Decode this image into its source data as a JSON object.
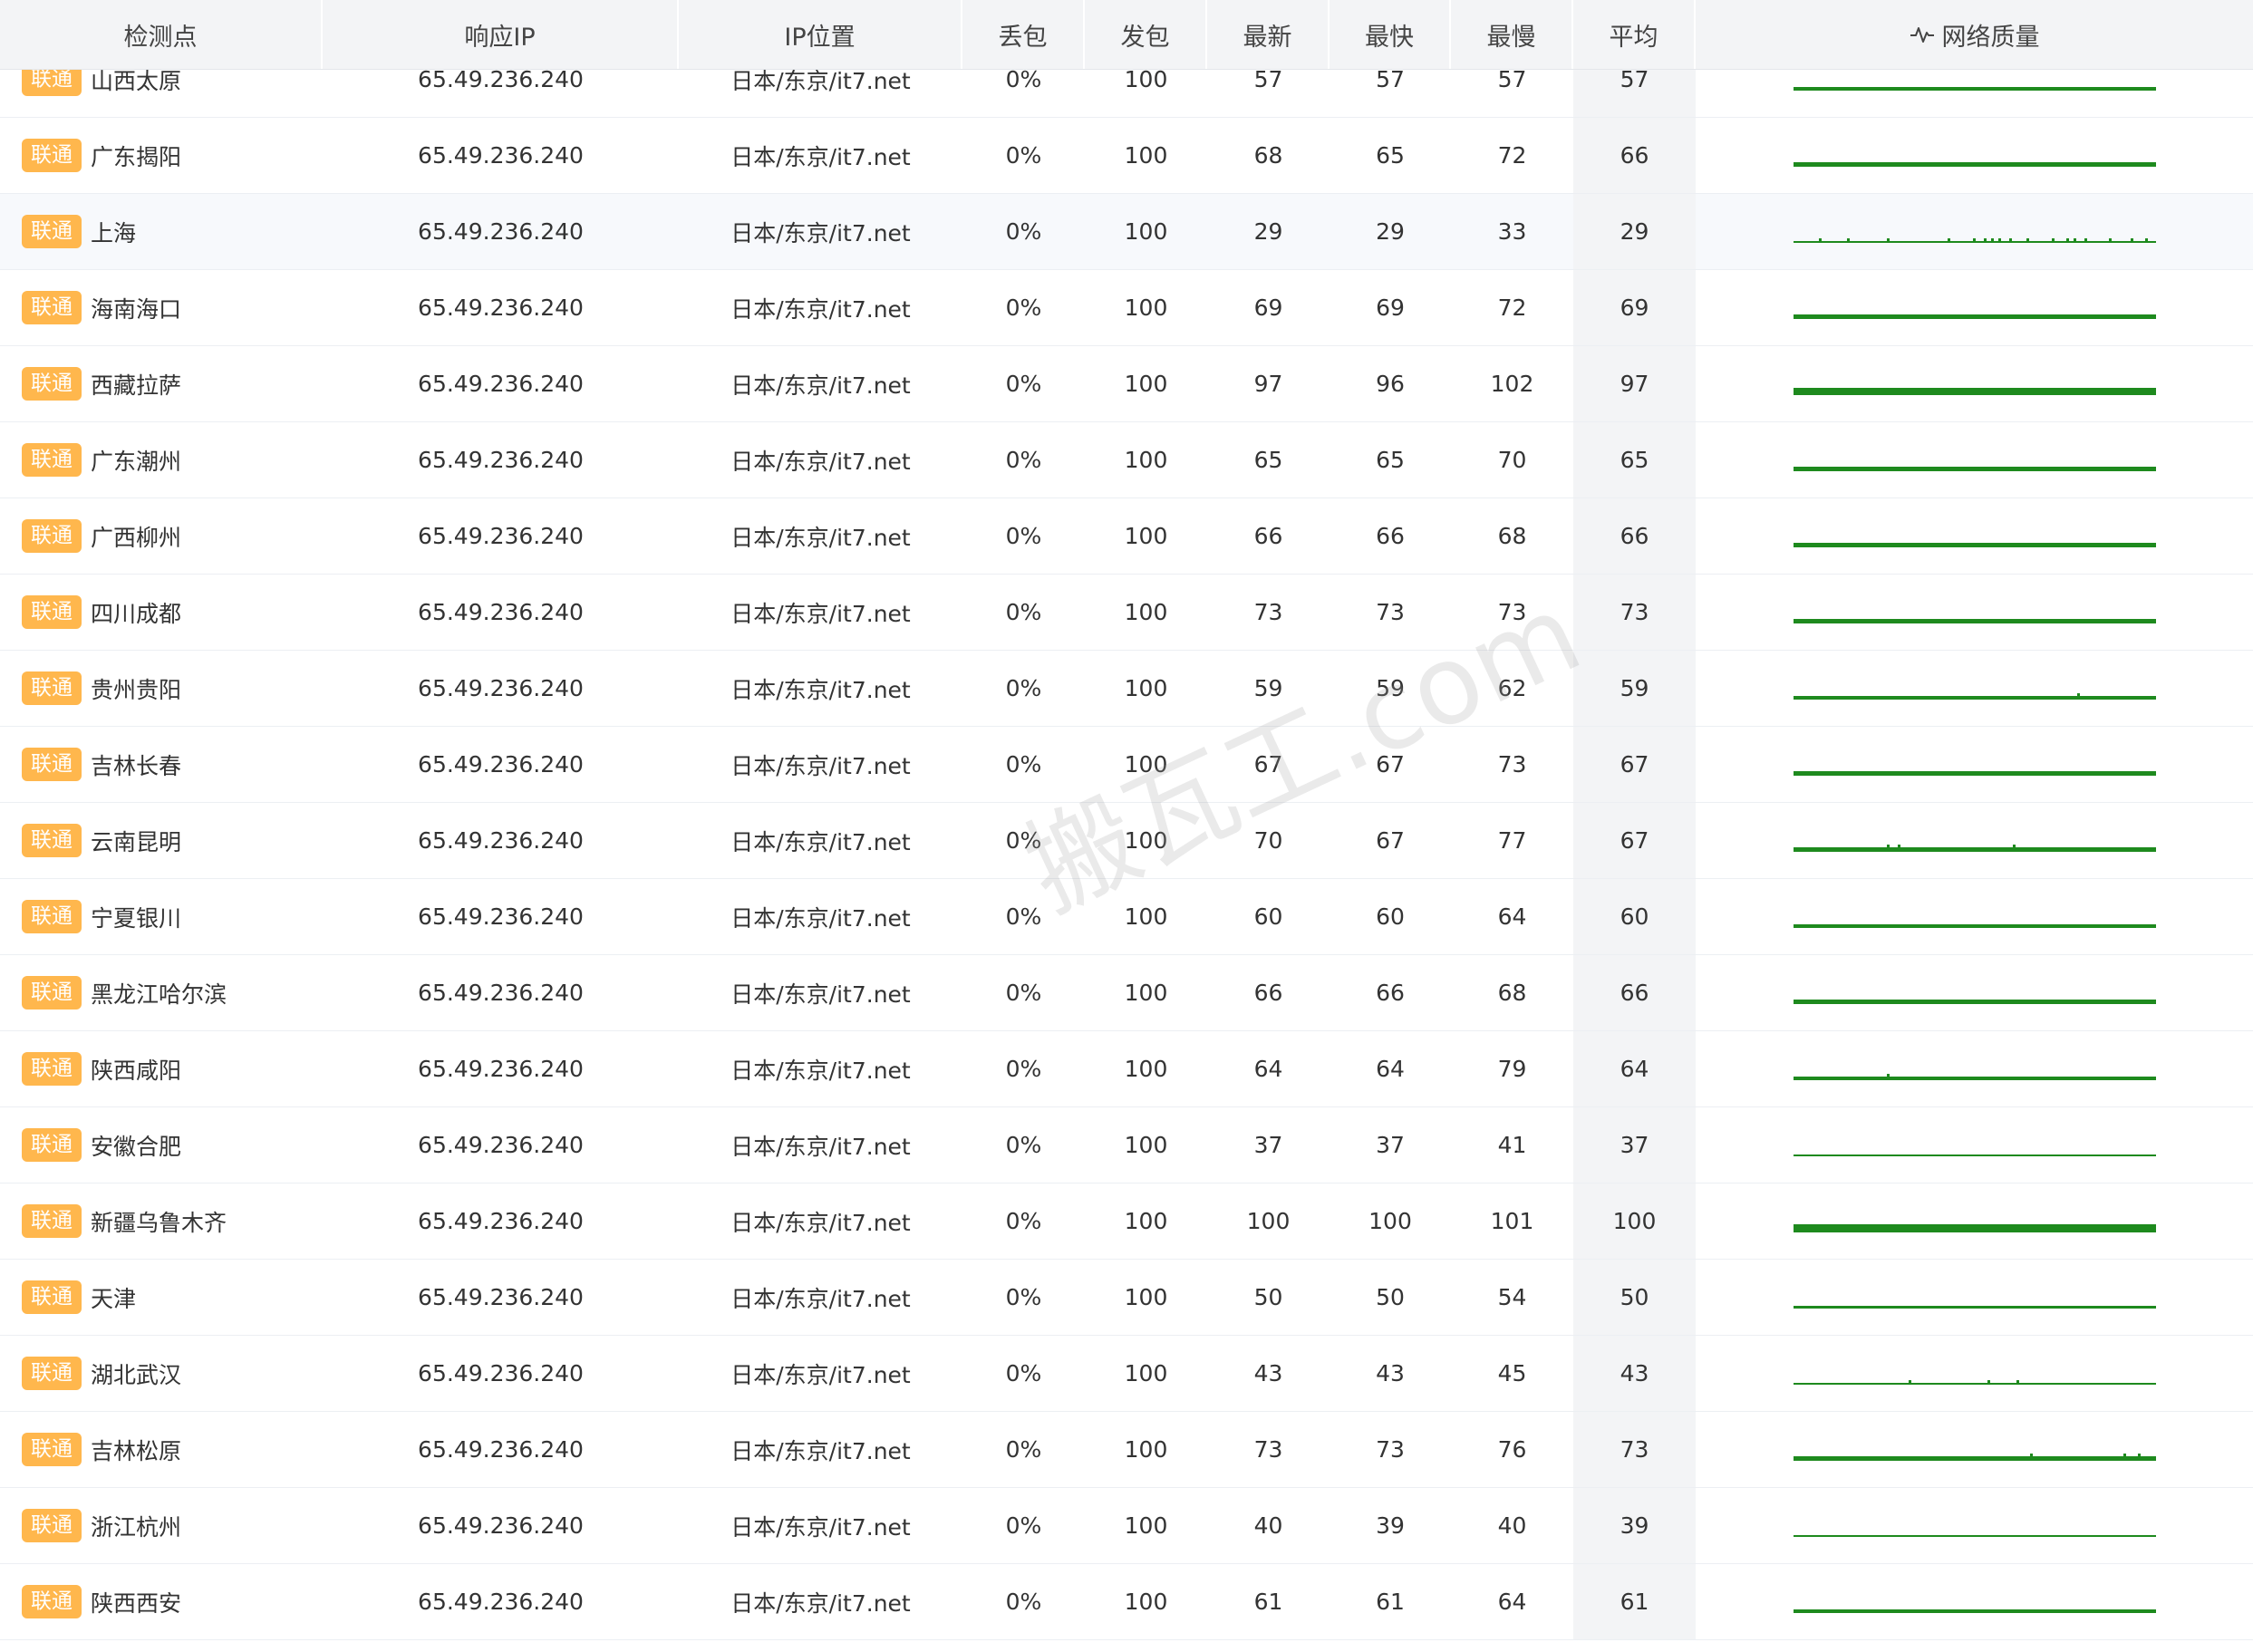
{
  "header": {
    "columns": [
      "检测点",
      "响应IP",
      "IP位置",
      "丢包",
      "发包",
      "最新",
      "最快",
      "最慢",
      "平均",
      "网络质量"
    ],
    "quality_icon": "pulse-icon"
  },
  "watermark": "搬瓦工.com",
  "colors": {
    "badge": "#ffb74d",
    "spark": "#1e8a1e",
    "header_bg": "#f3f4f6"
  },
  "rows": [
    {
      "isp": "联通",
      "loc": "山西太原",
      "ip": "65.49.236.240",
      "geo": "日本/东京/it7.net",
      "loss": "0%",
      "sent": "100",
      "latest": "57",
      "fast": "57",
      "slow": "57",
      "avg": "57",
      "spark": {
        "width": 4,
        "spikes": []
      }
    },
    {
      "isp": "联通",
      "loc": "广东揭阳",
      "ip": "65.49.236.240",
      "geo": "日本/东京/it7.net",
      "loss": "0%",
      "sent": "100",
      "latest": "68",
      "fast": "65",
      "slow": "72",
      "avg": "66",
      "spark": {
        "width": 5,
        "spikes": []
      }
    },
    {
      "isp": "联通",
      "loc": "上海",
      "ip": "65.49.236.240",
      "geo": "日本/东京/it7.net",
      "loss": "0%",
      "sent": "100",
      "latest": "29",
      "fast": "29",
      "slow": "33",
      "avg": "29",
      "spark": {
        "width": 2,
        "spikes": [
          0.07,
          0.15,
          0.26,
          0.43,
          0.5,
          0.53,
          0.55,
          0.57,
          0.6,
          0.65,
          0.72,
          0.76,
          0.78,
          0.81,
          0.88,
          0.94,
          0.98
        ]
      }
    },
    {
      "isp": "联通",
      "loc": "海南海口",
      "ip": "65.49.236.240",
      "geo": "日本/东京/it7.net",
      "loss": "0%",
      "sent": "100",
      "latest": "69",
      "fast": "69",
      "slow": "72",
      "avg": "69",
      "spark": {
        "width": 5,
        "spikes": []
      }
    },
    {
      "isp": "联通",
      "loc": "西藏拉萨",
      "ip": "65.49.236.240",
      "geo": "日本/东京/it7.net",
      "loss": "0%",
      "sent": "100",
      "latest": "97",
      "fast": "96",
      "slow": "102",
      "avg": "97",
      "spark": {
        "width": 8,
        "spikes": []
      }
    },
    {
      "isp": "联通",
      "loc": "广东潮州",
      "ip": "65.49.236.240",
      "geo": "日本/东京/it7.net",
      "loss": "0%",
      "sent": "100",
      "latest": "65",
      "fast": "65",
      "slow": "70",
      "avg": "65",
      "spark": {
        "width": 5,
        "spikes": []
      }
    },
    {
      "isp": "联通",
      "loc": "广西柳州",
      "ip": "65.49.236.240",
      "geo": "日本/东京/it7.net",
      "loss": "0%",
      "sent": "100",
      "latest": "66",
      "fast": "66",
      "slow": "68",
      "avg": "66",
      "spark": {
        "width": 5,
        "spikes": []
      }
    },
    {
      "isp": "联通",
      "loc": "四川成都",
      "ip": "65.49.236.240",
      "geo": "日本/东京/it7.net",
      "loss": "0%",
      "sent": "100",
      "latest": "73",
      "fast": "73",
      "slow": "73",
      "avg": "73",
      "spark": {
        "width": 5,
        "spikes": []
      }
    },
    {
      "isp": "联通",
      "loc": "贵州贵阳",
      "ip": "65.49.236.240",
      "geo": "日本/东京/it7.net",
      "loss": "0%",
      "sent": "100",
      "latest": "59",
      "fast": "59",
      "slow": "62",
      "avg": "59",
      "spark": {
        "width": 4,
        "spikes": [
          0.79
        ]
      }
    },
    {
      "isp": "联通",
      "loc": "吉林长春",
      "ip": "65.49.236.240",
      "geo": "日本/东京/it7.net",
      "loss": "0%",
      "sent": "100",
      "latest": "67",
      "fast": "67",
      "slow": "73",
      "avg": "67",
      "spark": {
        "width": 5,
        "spikes": []
      }
    },
    {
      "isp": "联通",
      "loc": "云南昆明",
      "ip": "65.49.236.240",
      "geo": "日本/东京/it7.net",
      "loss": "0%",
      "sent": "100",
      "latest": "70",
      "fast": "67",
      "slow": "77",
      "avg": "67",
      "spark": {
        "width": 5,
        "spikes": [
          0.26,
          0.29,
          0.61
        ]
      }
    },
    {
      "isp": "联通",
      "loc": "宁夏银川",
      "ip": "65.49.236.240",
      "geo": "日本/东京/it7.net",
      "loss": "0%",
      "sent": "100",
      "latest": "60",
      "fast": "60",
      "slow": "64",
      "avg": "60",
      "spark": {
        "width": 4,
        "spikes": []
      }
    },
    {
      "isp": "联通",
      "loc": "黑龙江哈尔滨",
      "ip": "65.49.236.240",
      "geo": "日本/东京/it7.net",
      "loss": "0%",
      "sent": "100",
      "latest": "66",
      "fast": "66",
      "slow": "68",
      "avg": "66",
      "spark": {
        "width": 5,
        "spikes": []
      }
    },
    {
      "isp": "联通",
      "loc": "陕西咸阳",
      "ip": "65.49.236.240",
      "geo": "日本/东京/it7.net",
      "loss": "0%",
      "sent": "100",
      "latest": "64",
      "fast": "64",
      "slow": "79",
      "avg": "64",
      "spark": {
        "width": 4,
        "spikes": [
          0.26
        ]
      }
    },
    {
      "isp": "联通",
      "loc": "安徽合肥",
      "ip": "65.49.236.240",
      "geo": "日本/东京/it7.net",
      "loss": "0%",
      "sent": "100",
      "latest": "37",
      "fast": "37",
      "slow": "41",
      "avg": "37",
      "spark": {
        "width": 2,
        "spikes": []
      }
    },
    {
      "isp": "联通",
      "loc": "新疆乌鲁木齐",
      "ip": "65.49.236.240",
      "geo": "日本/东京/it7.net",
      "loss": "0%",
      "sent": "100",
      "latest": "100",
      "fast": "100",
      "slow": "101",
      "avg": "100",
      "spark": {
        "width": 9,
        "spikes": []
      }
    },
    {
      "isp": "联通",
      "loc": "天津",
      "ip": "65.49.236.240",
      "geo": "日本/东京/it7.net",
      "loss": "0%",
      "sent": "100",
      "latest": "50",
      "fast": "50",
      "slow": "54",
      "avg": "50",
      "spark": {
        "width": 3,
        "spikes": []
      }
    },
    {
      "isp": "联通",
      "loc": "湖北武汉",
      "ip": "65.49.236.240",
      "geo": "日本/东京/it7.net",
      "loss": "0%",
      "sent": "100",
      "latest": "43",
      "fast": "43",
      "slow": "45",
      "avg": "43",
      "spark": {
        "width": 2,
        "spikes": [
          0.32,
          0.54,
          0.62
        ]
      }
    },
    {
      "isp": "联通",
      "loc": "吉林松原",
      "ip": "65.49.236.240",
      "geo": "日本/东京/it7.net",
      "loss": "0%",
      "sent": "100",
      "latest": "73",
      "fast": "73",
      "slow": "76",
      "avg": "73",
      "spark": {
        "width": 5,
        "spikes": [
          0.66,
          0.92,
          0.96
        ]
      }
    },
    {
      "isp": "联通",
      "loc": "浙江杭州",
      "ip": "65.49.236.240",
      "geo": "日本/东京/it7.net",
      "loss": "0%",
      "sent": "100",
      "latest": "40",
      "fast": "39",
      "slow": "40",
      "avg": "39",
      "spark": {
        "width": 2,
        "spikes": []
      }
    },
    {
      "isp": "联通",
      "loc": "陕西西安",
      "ip": "65.49.236.240",
      "geo": "日本/东京/it7.net",
      "loss": "0%",
      "sent": "100",
      "latest": "61",
      "fast": "61",
      "slow": "64",
      "avg": "61",
      "spark": {
        "width": 4,
        "spikes": []
      }
    }
  ]
}
